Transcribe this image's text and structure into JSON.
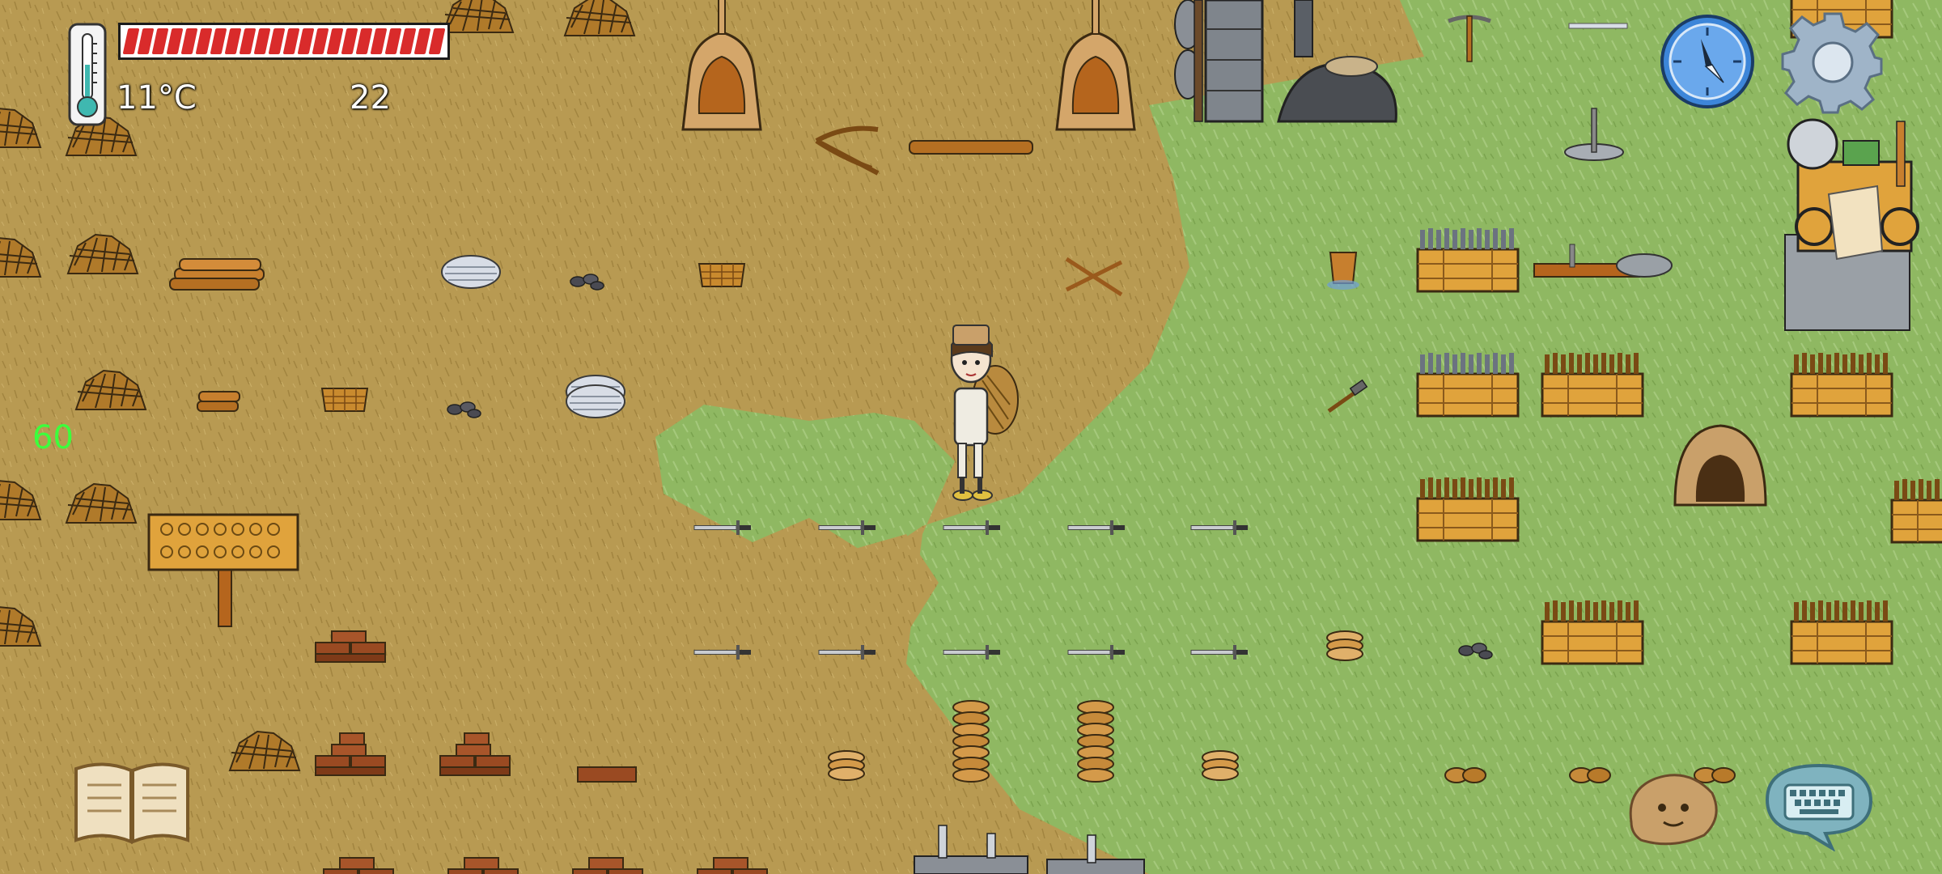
{
  "hud": {
    "temperature": "11°C",
    "food_count": "22",
    "fps": "60",
    "health_segments": 22
  },
  "icons": {
    "thermometer": "thermometer-icon",
    "compass": "compass-icon",
    "settings": "gear-icon",
    "book": "recipe-book-icon",
    "emote": "emote-face-icon",
    "keyboard": "keyboard-chat-icon"
  },
  "colors": {
    "dirt": "#b89a52",
    "grass": "#8fb862",
    "health": "#d92b2b",
    "fps": "#3cff3c",
    "compass": "#3d86d9",
    "chat_bubble": "#7fb3bf"
  }
}
